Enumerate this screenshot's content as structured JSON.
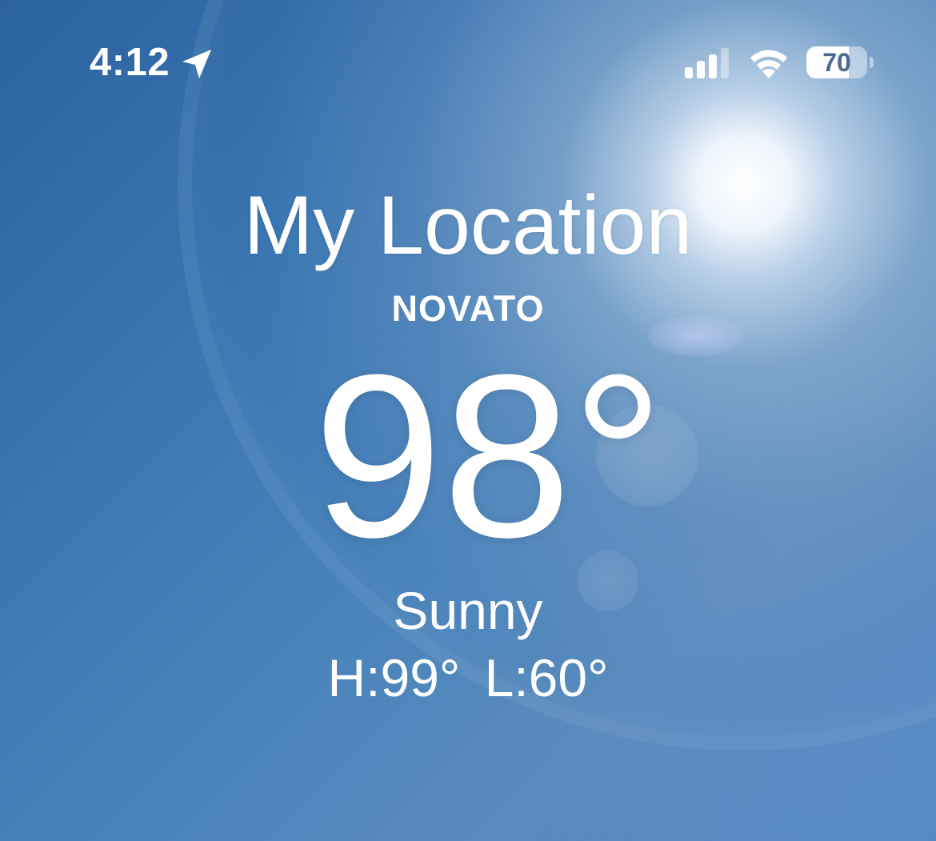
{
  "status_bar": {
    "time": "4:12",
    "location_icon": "location-arrow-icon",
    "signal_icon": "cellular-signal-icon",
    "signal_bars_active": 3,
    "signal_bars_total": 4,
    "wifi_icon": "wifi-icon",
    "battery_icon": "battery-icon",
    "battery_percent": "70",
    "battery_level": 0.7
  },
  "weather": {
    "location_title": "My Location",
    "city": "NOVATO",
    "temperature": "98°",
    "condition": "Sunny",
    "high_low": "H:99°  L:60°"
  },
  "colors": {
    "sky_blue": "#3a76b2",
    "text": "#ffffff"
  }
}
